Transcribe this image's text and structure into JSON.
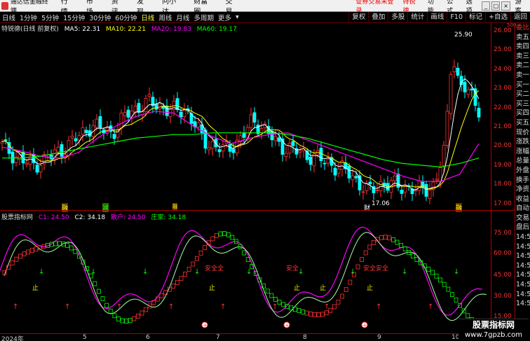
{
  "app": {
    "name": "通达信金融终端",
    "menus": [
      "行情",
      "市场",
      "资讯",
      "发现",
      "问小达",
      "财富圈",
      "交易"
    ],
    "alert": "证券交易未登录",
    "stock_name": "特锐德",
    "right_menus": [
      "功能",
      "公式",
      "选项"
    ],
    "user_label": "游客"
  },
  "periods": [
    "日线",
    "1分钟",
    "5分钟",
    "15分钟",
    "30分钟",
    "60分钟",
    "日线",
    "周线",
    "月线",
    "多周期",
    "更多"
  ],
  "tools": [
    "复权",
    "叠加",
    "多股",
    "统计",
    "画线",
    "F10",
    "标记",
    "+自选",
    "返回"
  ],
  "legend": {
    "title": "特锐德(日线 前复权)",
    "ma5": "MA5: 22.31",
    "ma10": "MA10: 22.21",
    "ma20": "MA20: 19.83",
    "ma60": "MA60: 19.17"
  },
  "price_ticks": [
    "26.00",
    "25.00",
    "24.00",
    "23.00",
    "22.00",
    "21.00",
    "20.00",
    "19.00",
    "18.00",
    "17.00"
  ],
  "axis_extra": "500",
  "high_label": "25.90",
  "low_label": "17.06",
  "event_markers": [
    "融",
    "减",
    "融",
    "财",
    "融"
  ],
  "right_panel": [
    "委比",
    "卖五",
    "卖四",
    "卖三",
    "卖二",
    "卖一",
    "买一",
    "买二",
    "买三",
    "买四",
    "买五",
    "现价",
    "涨跌",
    "涨幅",
    "总量",
    "外盘",
    "换手",
    "净资",
    "收益",
    "自动",
    "交易",
    "盘后",
    "14:50",
    "14:50",
    "14:50",
    "14:50",
    "14:50",
    "14:50",
    "14:50",
    "14:50"
  ],
  "indicator": {
    "name": "股票指标网",
    "c1": "C1: 24.50",
    "c2": "C2: 34.18",
    "sh": "散户: 24.50",
    "zj": "庄家: 34.18",
    "labels": [
      "安全全",
      "安全",
      "安全安全"
    ],
    "up_labels": [
      "止",
      "止",
      "止",
      "止",
      "止"
    ],
    "ticks": [
      "75.00",
      "60.00",
      "45.00",
      "30.00",
      "15.00"
    ]
  },
  "dates": [
    "2024年",
    "5",
    "6",
    "7",
    "8",
    "9",
    "10"
  ],
  "watermark": {
    "line1": "股票指标网",
    "line2": "www.7gpzb.com"
  },
  "colors": {
    "up": "#ff3333",
    "down": "#00ffff",
    "ma5": "#ffffff",
    "ma10": "#ffff00",
    "ma20": "#ff00ff",
    "ma60": "#00ff00",
    "axis": "#ee3333"
  },
  "chart_data": {
    "type": "line",
    "title": "特锐德(日线 前复权)",
    "ylim": [
      16.7,
      26.3
    ],
    "series": [
      {
        "name": "MA20",
        "values": [
          19.8,
          19.6,
          19.3,
          19.2,
          19.5,
          20.3,
          21.0,
          21.5,
          21.8,
          21.7,
          21.0,
          20.4,
          20.0,
          20.3,
          20.5,
          20.6,
          20.2,
          19.8,
          19.4,
          19.0,
          18.6,
          18.2,
          17.9,
          17.9,
          18.3,
          20.0
        ]
      },
      {
        "name": "MA60",
        "values": [
          19.2,
          19.2,
          19.3,
          19.5,
          19.7,
          19.9,
          20.1,
          20.3,
          20.4,
          20.5,
          20.5,
          20.6,
          20.6,
          20.6,
          20.6,
          20.5,
          20.3,
          20.0,
          19.7,
          19.4,
          19.1,
          18.9,
          18.8,
          18.7,
          18.9,
          19.2
        ]
      }
    ]
  }
}
